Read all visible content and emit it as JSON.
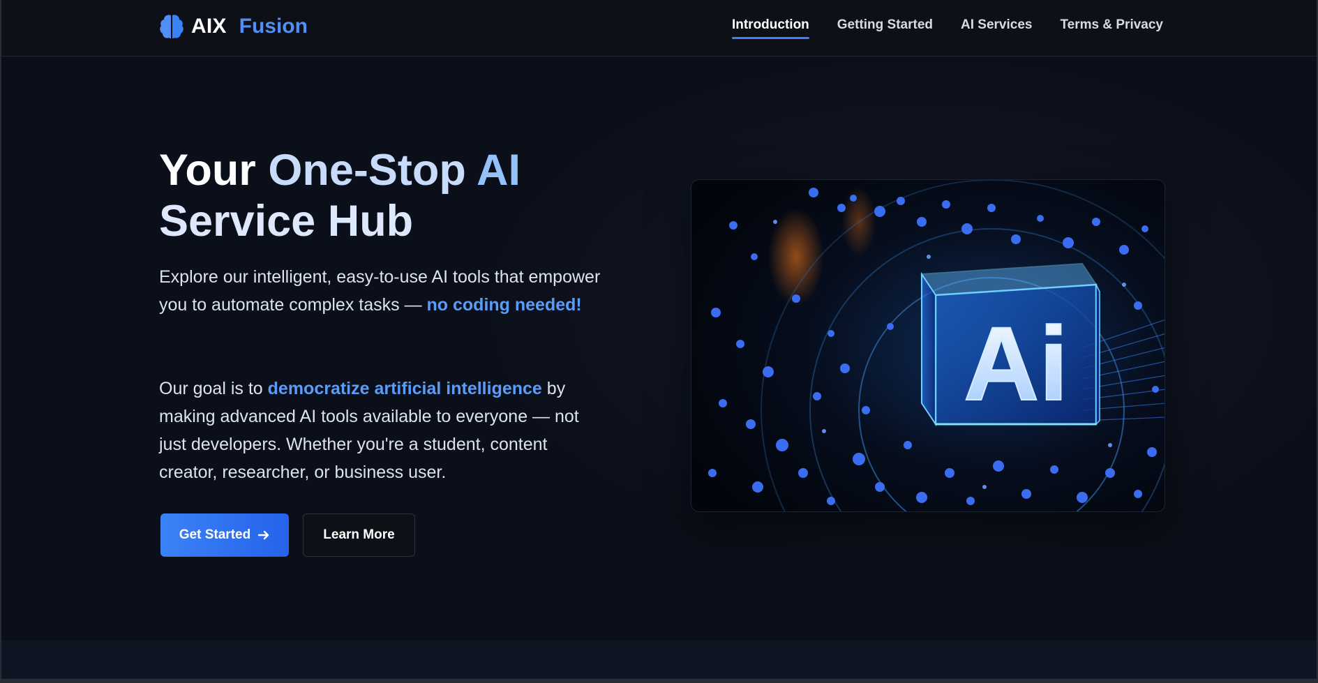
{
  "header": {
    "logo_icon": "brain-icon",
    "logo_primary": "AIX",
    "logo_accent": "Fusion",
    "nav": [
      {
        "label": "Introduction",
        "active": true
      },
      {
        "label": "Getting Started",
        "active": false
      },
      {
        "label": "AI Services",
        "active": false
      },
      {
        "label": "Terms & Privacy",
        "active": false
      }
    ]
  },
  "hero": {
    "headline_part1": "Your ",
    "headline_part2": "One-Stop ",
    "headline_part3": "AI",
    "headline_part4": "Service Hub",
    "para1_text": "Explore our intelligent, easy-to-use AI tools that empower you to automate complex tasks — ",
    "para1_highlight": "no coding needed!",
    "para2_prefix": "Our goal is to ",
    "para2_highlight": "democratize artificial intelligence",
    "para2_suffix": " by making advanced AI tools available to everyone — not just developers. Whether you're a student, content creator, researcher, or business user.",
    "primary_button": "Get Started",
    "primary_button_icon": "arrow-right-icon",
    "secondary_button": "Learn More",
    "image_text": "Ai"
  },
  "colors": {
    "background": "#0b0f19",
    "header": "#0d1117",
    "accent": "#3b82f6",
    "highlight": "#5b9cf8"
  }
}
